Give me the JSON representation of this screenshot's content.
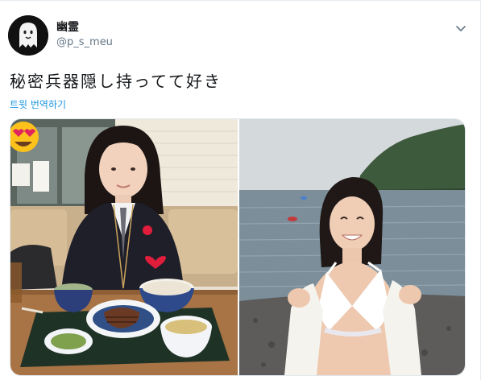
{
  "user": {
    "display_name": "幽霊",
    "handle": "@p_s_meu"
  },
  "tweet": {
    "text": "秘密兵器隠し持ってて好き",
    "translate_label": "트윗 번역하기"
  },
  "media": {
    "photos": [
      {
        "name": "restaurant-photo"
      },
      {
        "name": "beach-photo"
      }
    ]
  },
  "icons": {
    "avatar": "ghost-avatar-icon",
    "caret": "chevron-down-icon",
    "emoji": "heart-eyes-emoji-icon",
    "hearts": "red-heart-icon"
  },
  "colors": {
    "link": "#1b95e0",
    "handle": "#657786",
    "text": "#14171a",
    "border": "#e1e8ed"
  }
}
